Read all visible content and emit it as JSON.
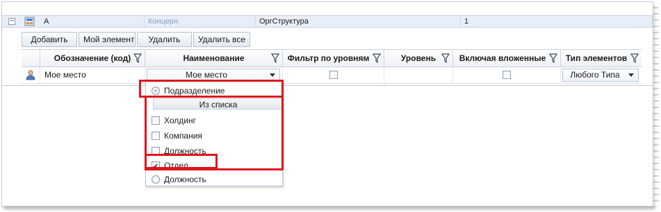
{
  "group_row": {
    "code": "A",
    "parent": "Концерн",
    "type": "ОргСтруктура",
    "count": "1",
    "collapse_symbol": "−"
  },
  "toolbar": {
    "add_label": "Добавить",
    "my_element_label": "Мой элемент",
    "delete_label": "Удалить",
    "delete_all_label": "Удалить все"
  },
  "columns": {
    "code": "Обозначение (код)",
    "name": "Наименование",
    "level_filter": "Фильтр по уровням",
    "level": "Уровень",
    "include_nested": "Включая вложенные",
    "element_type": "Тип элементов"
  },
  "row": {
    "code": "Мое место",
    "name": "Мое место",
    "level_filter_checked": false,
    "include_nested_checked": false,
    "element_type": "Любого Типа"
  },
  "dropdown": {
    "option_subdivision": "Подразделение",
    "from_list_header": "Из списка",
    "items": [
      {
        "label": "Холдинг",
        "checked": false
      },
      {
        "label": "Компания",
        "checked": false
      },
      {
        "label": "Должность",
        "checked": false
      },
      {
        "label": "Отдел",
        "checked": true
      }
    ],
    "option_position": "Должность"
  },
  "icons": {
    "filter": "filter-icon",
    "user": "user-icon",
    "org": "org-structure-icon",
    "dropdown_arrow": "chevron-down-icon"
  },
  "colors": {
    "highlight": "#e0141e",
    "group_row": "#e8eef8",
    "parent_text": "#8aa0c8"
  }
}
